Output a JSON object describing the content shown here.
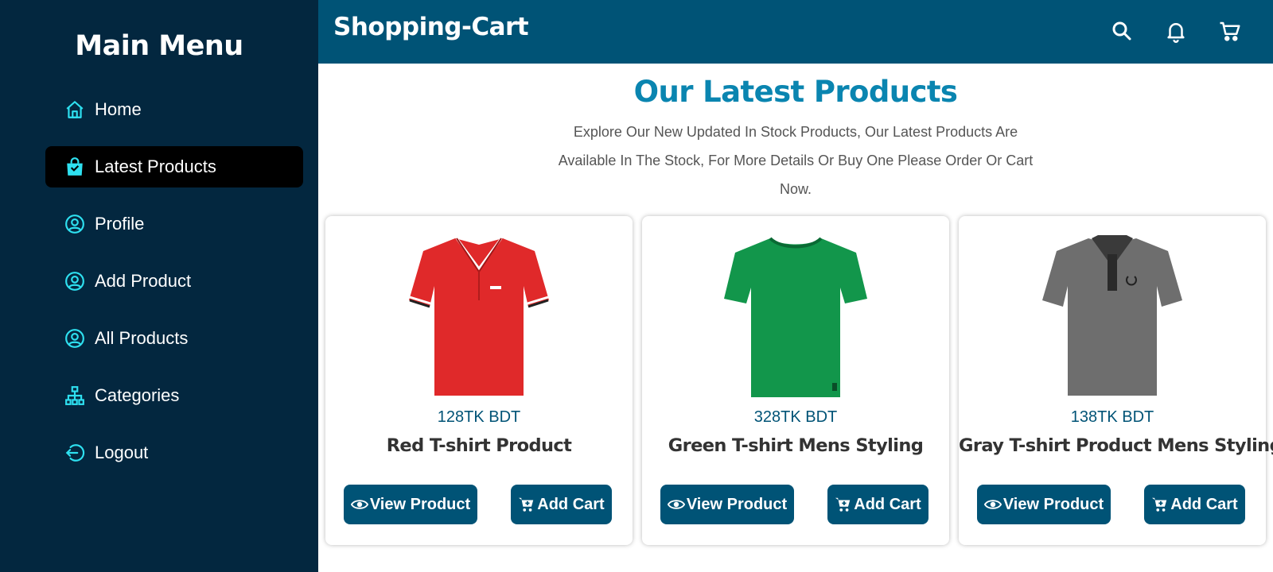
{
  "sidebar": {
    "title": "Main Menu",
    "items": [
      {
        "label": "Home",
        "icon": "home-icon",
        "active": false
      },
      {
        "label": "Latest Products",
        "icon": "shopping-bag-icon",
        "active": true
      },
      {
        "label": "Profile",
        "icon": "user-circle-icon",
        "active": false
      },
      {
        "label": "Add Product",
        "icon": "user-circle-icon",
        "active": false
      },
      {
        "label": "All Products",
        "icon": "user-circle-icon",
        "active": false
      },
      {
        "label": "Categories",
        "icon": "sitemap-icon",
        "active": false
      },
      {
        "label": "Logout",
        "icon": "logout-icon",
        "active": false
      }
    ]
  },
  "header": {
    "brand": "Shopping-Cart",
    "icons": [
      "search-icon",
      "bell-icon",
      "cart-icon"
    ]
  },
  "main": {
    "title": "Our Latest Products",
    "description": "Explore Our New Updated In Stock Products, Our Latest Products Are Available In The Stock, For More Details Or Buy One Please Order Or Cart Now.",
    "products": [
      {
        "price": "128TK BDT",
        "name": "Red T-shirt Product",
        "color": "#e0292a",
        "image": "red-polo-shirt-image"
      },
      {
        "price": "328TK BDT",
        "name": "Green T-shirt Mens Styling",
        "color": "#12964b",
        "image": "green-t-shirt-image"
      },
      {
        "price": "138TK BDT",
        "name": "Gray T-shirt Product Mens Styling",
        "color": "#6e6e6e",
        "image": "gray-polo-shirt-image"
      }
    ],
    "view_label": "View Product",
    "cart_label": "Add Cart"
  },
  "colors": {
    "sidebar_bg": "#03273f",
    "header_bg": "#005376",
    "accent_cyan": "#2ee0f0",
    "title_blue": "#0a85b0",
    "button_bg": "#005376"
  }
}
